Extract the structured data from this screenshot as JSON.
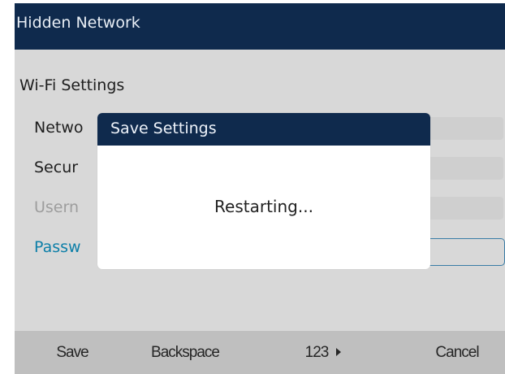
{
  "window": {
    "title": "Hidden Network"
  },
  "settings": {
    "heading": "Wi-Fi Settings",
    "rows": [
      {
        "label": "Netwo"
      },
      {
        "label": "Secur"
      },
      {
        "label": "Usern"
      },
      {
        "label": "Passw"
      }
    ]
  },
  "dialog": {
    "title": "Save Settings",
    "message": "Restarting..."
  },
  "softkeys": {
    "save": "Save",
    "backspace": "Backspace",
    "numeric": "123",
    "cancel": "Cancel"
  },
  "icons": {
    "numeric_arrow": "triangle-right-icon"
  },
  "colors": {
    "title_bar": "#0f2a4d",
    "background": "#d8d8d8",
    "softkey_bar": "#bfbfbf",
    "password_label": "#0d7fa8",
    "dialog_background": "#ffffff"
  }
}
